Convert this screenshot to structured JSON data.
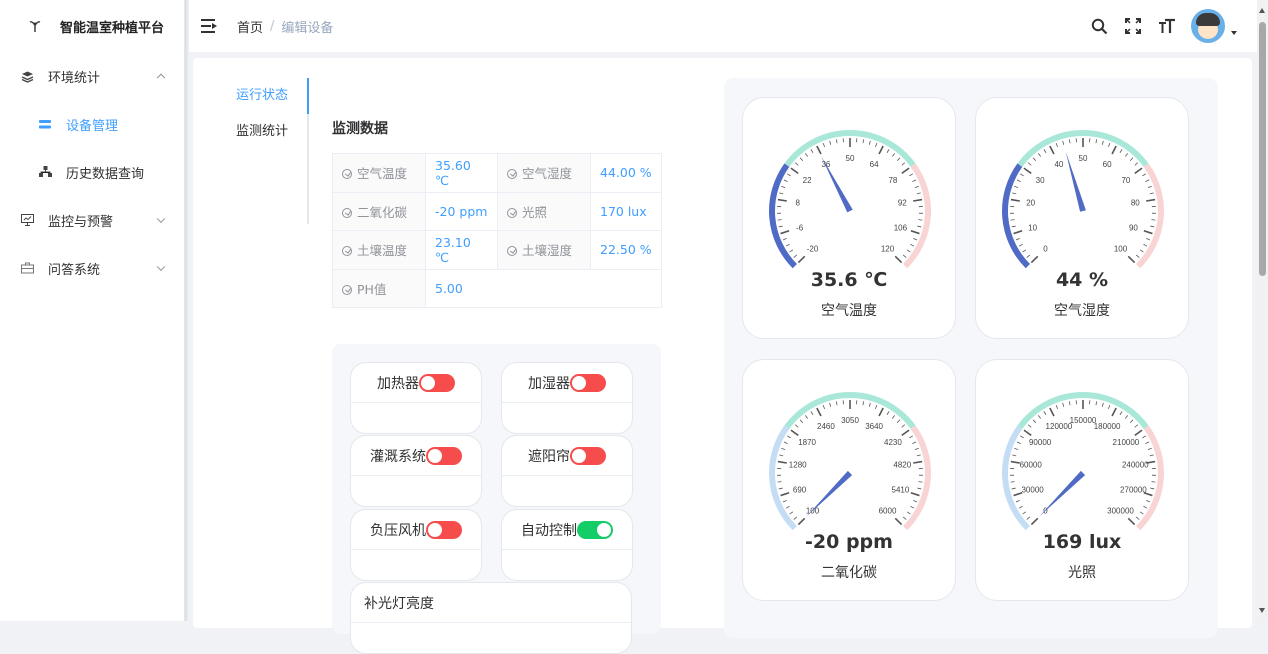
{
  "app": {
    "title": "智能温室种植平台"
  },
  "sidebar": {
    "items": [
      {
        "label": "环境统计",
        "icon": "layers-icon",
        "expanded": true
      },
      {
        "label": "设备管理",
        "icon": "list-icon",
        "active": true
      },
      {
        "label": "历史数据查询",
        "icon": "tree-icon"
      },
      {
        "label": "监控与预警",
        "icon": "monitor-icon"
      },
      {
        "label": "问答系统",
        "icon": "briefcase-icon"
      }
    ]
  },
  "breadcrumb": {
    "home": "首页",
    "sep": "/",
    "current": "编辑设备"
  },
  "header": {
    "icons": [
      "search-icon",
      "fullscreen-icon",
      "font-size-icon"
    ],
    "avatar": "user-avatar"
  },
  "tabs": [
    {
      "label": "运行状态",
      "active": true
    },
    {
      "label": "监测统计"
    }
  ],
  "monitor": {
    "title": "监测数据",
    "rows": [
      [
        {
          "label": "空气温度",
          "value": "35.60 ℃"
        },
        {
          "label": "空气湿度",
          "value": "44.00 %"
        }
      ],
      [
        {
          "label": "二氧化碳",
          "value": "-20 ppm"
        },
        {
          "label": "光照",
          "value": "170 lux"
        }
      ],
      [
        {
          "label": "土壤温度",
          "value": "23.10 ℃"
        },
        {
          "label": "土壤湿度",
          "value": "22.50 %"
        }
      ],
      [
        {
          "label": "PH值",
          "value": "5.00"
        }
      ]
    ]
  },
  "controls": [
    {
      "label": "加热器",
      "on": false
    },
    {
      "label": "加湿器",
      "on": false
    },
    {
      "label": "灌溉系统",
      "on": false
    },
    {
      "label": "遮阳帘",
      "on": false
    },
    {
      "label": "负压风机",
      "on": false
    },
    {
      "label": "自动控制",
      "on": true
    },
    {
      "label": "补光灯亮度"
    }
  ],
  "gauges": [
    {
      "name": "空气温度",
      "display": "35.6 ℃",
      "value": 35.6,
      "min": -20,
      "max": 120,
      "ticks": [
        "-20",
        "-6",
        "8",
        "22",
        "36",
        "50",
        "64",
        "78",
        "92",
        "106",
        "120"
      ],
      "colors": [
        "#4f6bc5",
        "#a9e8d9",
        "#f8d4d4"
      ]
    },
    {
      "name": "空气湿度",
      "display": "44 %",
      "value": 44,
      "min": 0,
      "max": 100,
      "ticks": [
        "0",
        "10",
        "20",
        "30",
        "40",
        "50",
        "60",
        "70",
        "80",
        "90",
        "100"
      ],
      "colors": [
        "#4f6bc5",
        "#a9e8d9",
        "#f8d4d4"
      ]
    },
    {
      "name": "二氧化碳",
      "display": "-20 ppm",
      "value": -20,
      "min": 100,
      "max": 6000,
      "ticks": [
        "100",
        "690",
        "1280",
        "1870",
        "2460",
        "3050",
        "3640",
        "4230",
        "4820",
        "5410",
        "6000"
      ],
      "colors": [
        "#c4ddf5",
        "#a9e8d9",
        "#f8d4d4"
      ]
    },
    {
      "name": "光照",
      "display": "169 lux",
      "value": 169,
      "min": 0,
      "max": 300000,
      "ticks": [
        "0",
        "30000",
        "60000",
        "90000",
        "120000",
        "150000",
        "180000",
        "210000",
        "240000",
        "270000",
        "300000"
      ],
      "colors": [
        "#c4ddf5",
        "#a9e8d9",
        "#f8d4d4"
      ]
    }
  ]
}
